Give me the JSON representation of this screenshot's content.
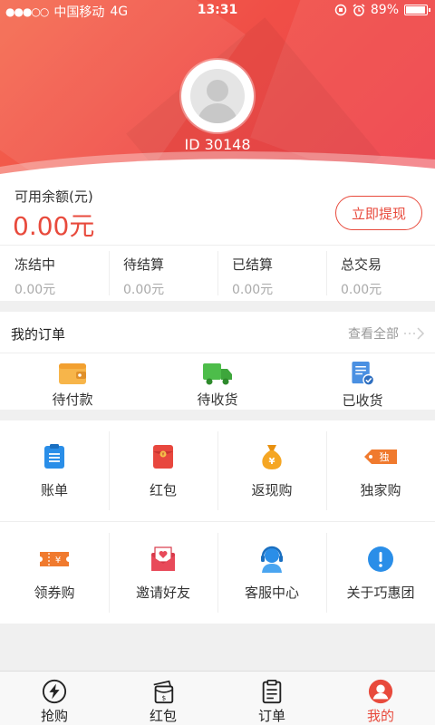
{
  "status_bar": {
    "carrier": "中国移动",
    "network": "4G",
    "time": "13:31",
    "battery": "89%"
  },
  "profile": {
    "user_id": "ID 30148"
  },
  "balance": {
    "label": "可用余额(元)",
    "amount": "0.00元",
    "withdraw_label": "立即提现"
  },
  "stats": [
    {
      "label": "冻结中",
      "value": "0.00元"
    },
    {
      "label": "待结算",
      "value": "0.00元"
    },
    {
      "label": "已结算",
      "value": "0.00元"
    },
    {
      "label": "总交易",
      "value": "0.00元"
    }
  ],
  "orders": {
    "title": "我的订单",
    "view_all": "查看全部",
    "items": [
      {
        "label": "待付款",
        "icon": "wallet-icon"
      },
      {
        "label": "待收货",
        "icon": "truck-icon"
      },
      {
        "label": "已收货",
        "icon": "receipt-check-icon"
      }
    ]
  },
  "grid": [
    {
      "label": "账单",
      "icon": "bill-icon"
    },
    {
      "label": "红包",
      "icon": "red-envelope-icon"
    },
    {
      "label": "返现购",
      "icon": "money-bag-icon"
    },
    {
      "label": "独家购",
      "icon": "exclusive-tag-icon"
    },
    {
      "label": "领券购",
      "icon": "coupon-icon"
    },
    {
      "label": "邀请好友",
      "icon": "invite-envelope-icon"
    },
    {
      "label": "客服中心",
      "icon": "customer-service-icon"
    },
    {
      "label": "关于巧惠团",
      "icon": "info-icon"
    }
  ],
  "tabbar": [
    {
      "label": "抢购",
      "icon": "lightning-icon"
    },
    {
      "label": "红包",
      "icon": "red-envelope-icon"
    },
    {
      "label": "订单",
      "icon": "clipboard-icon"
    },
    {
      "label": "我的",
      "icon": "profile-icon",
      "active": true
    }
  ],
  "colors": {
    "accent": "#e84a3c",
    "header": "#f04f47"
  }
}
